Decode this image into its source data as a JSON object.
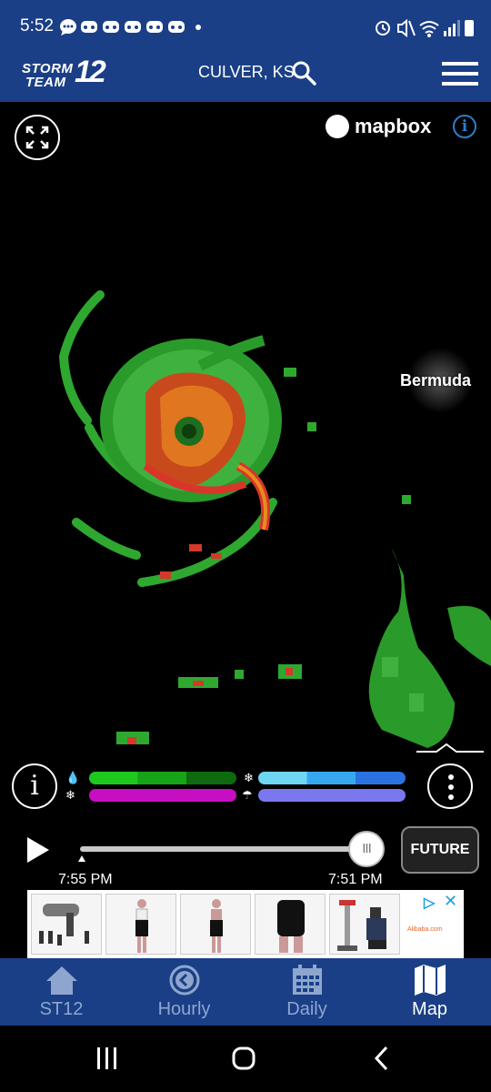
{
  "status_bar": {
    "time": "5:52",
    "notification_icons": [
      "chat-icon",
      "discord-icon",
      "discord-icon",
      "discord-icon",
      "discord-icon",
      "discord-icon",
      "dot-icon"
    ],
    "system_icons": [
      "alarm-icon",
      "mute-icon",
      "wifi-icon",
      "signal-icon",
      "battery-icon"
    ]
  },
  "header": {
    "logo": {
      "line1": "STORM",
      "line2": "TEAM",
      "number": "12"
    },
    "location": "CULVER, KS",
    "search_icon": "search-icon",
    "menu_icon": "hamburger-menu-icon"
  },
  "map": {
    "attribution": "mapbox",
    "place_label": "Bermuda",
    "expand_icon": "expand-icon",
    "info_icon": "info-icon",
    "info_text": "i"
  },
  "legend": {
    "info_text": "i",
    "rain_icon": "rain-icon",
    "snow_icon": "snow-icon",
    "mix_icon": "mix-icon",
    "ice_icon": "ice-icon",
    "colors": {
      "rain": [
        "#1ec81e",
        "#17a317",
        "#0e6a0e"
      ],
      "snow": [
        "#6fd6f2",
        "#38a8ee",
        "#2b72e0"
      ],
      "mix": "#c60fc3",
      "ice": "#7a78ef"
    },
    "layers_icon": "more-vertical-icon"
  },
  "timeline": {
    "start_time": "7:55 PM",
    "end_time": "7:51 PM",
    "future_label": "FUTURE",
    "progress": 1.0,
    "thumb_glyph": "III"
  },
  "ad": {
    "brand": "Alibaba.com",
    "adchoices": "▷",
    "close": "✕"
  },
  "bottom_nav": {
    "items": [
      {
        "label": "ST12",
        "icon": "home-icon",
        "active": false
      },
      {
        "label": "Hourly",
        "icon": "clock-icon",
        "active": false
      },
      {
        "label": "Daily",
        "icon": "calendar-icon",
        "active": false
      },
      {
        "label": "Map",
        "icon": "map-icon",
        "active": true
      }
    ]
  },
  "system_nav": {
    "buttons": [
      "recents-icon",
      "home-circle-icon",
      "back-icon"
    ]
  },
  "theme": {
    "brand_blue": "#1a3f86",
    "inactive_nav": "#8ea6cf",
    "link_blue": "#2a7fcb"
  }
}
